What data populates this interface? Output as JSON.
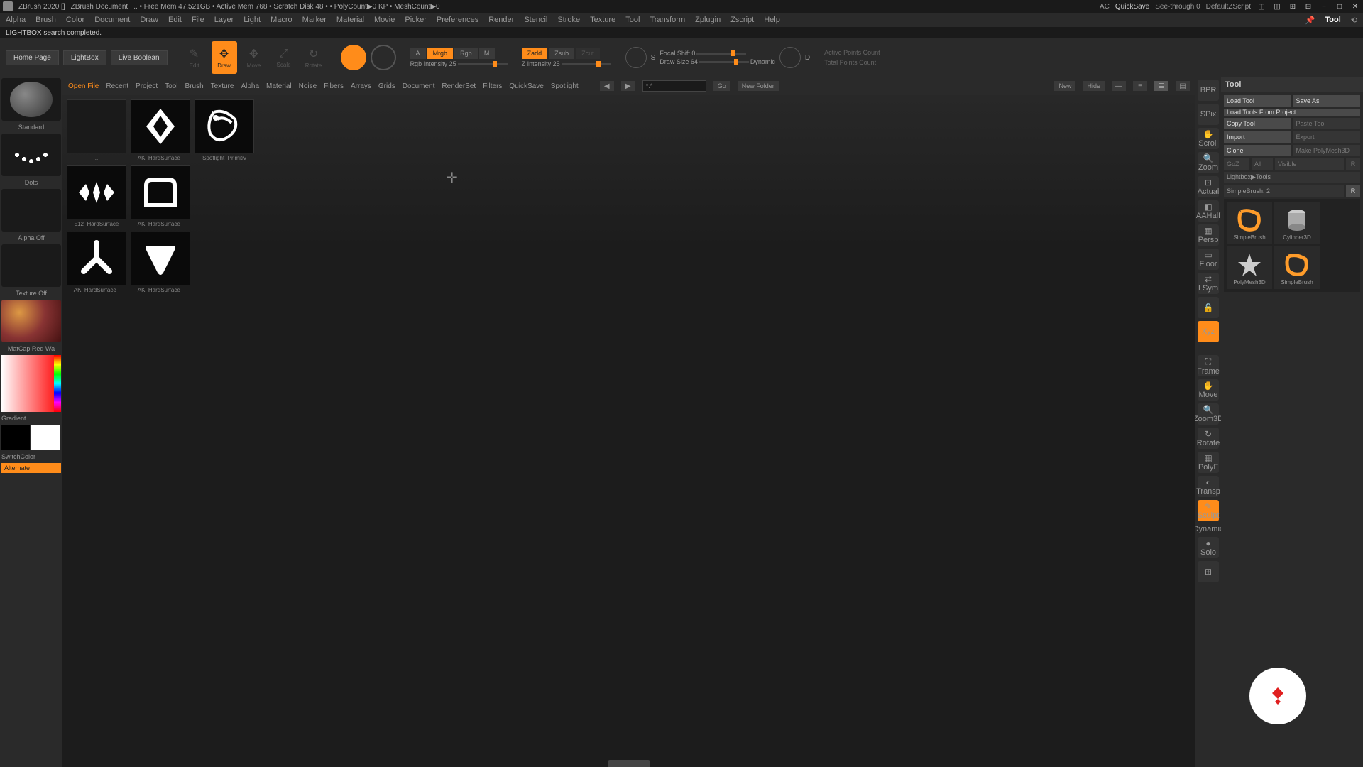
{
  "title_bar": {
    "app": "ZBrush 2020 []",
    "doc": "ZBrush Document",
    "mem": ".. • Free Mem 47.521GB • Active Mem 768 • Scratch Disk 48 • • PolyCount▶0 KP • MeshCount▶0",
    "ac": "AC",
    "quicksave": "QuickSave",
    "seethrough": "See-through  0",
    "default_zs": "DefaultZScript"
  },
  "menu": [
    "Alpha",
    "Brush",
    "Color",
    "Document",
    "Draw",
    "Edit",
    "File",
    "Layer",
    "Light",
    "Macro",
    "Marker",
    "Material",
    "Movie",
    "Picker",
    "Preferences",
    "Render",
    "Stencil",
    "Stroke",
    "Texture",
    "Tool",
    "Transform",
    "Zplugin",
    "Zscript",
    "Help"
  ],
  "status": "LIGHTBOX search completed.",
  "toolbar": {
    "home": "Home Page",
    "lightbox": "LightBox",
    "live_bool": "Live Boolean",
    "modes": {
      "edit": "Edit",
      "draw": "Draw",
      "move": "Move",
      "scale": "Scale",
      "rotate": "Rotate"
    },
    "a": "A",
    "mrgb": "Mrgb",
    "rgb": "Rgb",
    "m": "M",
    "rgb_int": "Rgb Intensity 25",
    "zadd": "Zadd",
    "zsub": "Zsub",
    "zcut": "Zcut",
    "z_int": "Z Intensity 25",
    "s_label": "S",
    "focal": "Focal Shift 0",
    "draw_size": "Draw Size 64",
    "dynamic": "Dynamic",
    "d_label": "D",
    "active_pts": "Active Points Count",
    "total_pts": "Total Points Count"
  },
  "left_palette": {
    "standard": "Standard",
    "dots": "Dots",
    "alpha_off": "Alpha Off",
    "texture_off": "Texture Off",
    "material": "MatCap Red Wa",
    "gradient": "Gradient",
    "switch_color": "SwitchColor",
    "alternate": "Alternate"
  },
  "lightbox": {
    "tabs": [
      "Open File",
      "Recent",
      "Project",
      "Tool",
      "Brush",
      "Texture",
      "Alpha",
      "Material",
      "Noise",
      "Fibers",
      "Arrays",
      "Grids",
      "Document",
      "RenderSet",
      "Filters",
      "QuickSave",
      "Spotlight"
    ],
    "active_tab": "Open File",
    "underline_tab": "Spotlight",
    "search_placeholder": "*.*",
    "go": "Go",
    "new_folder": "New Folder",
    "new": "New",
    "hide": "Hide",
    "items": [
      {
        "name": "..",
        "type": "folder"
      },
      {
        "name": "AK_HardSurface_",
        "type": "x"
      },
      {
        "name": "Spotlight_Primitiv",
        "type": "zlogo"
      },
      {
        "name": "512_HardSurface",
        "type": "diamond"
      },
      {
        "name": "AK_HardSurface_",
        "type": "tab"
      },
      {
        "name": "AK_HardSurface_",
        "type": "tri3"
      },
      {
        "name": "AK_HardSurface_",
        "type": "shield"
      }
    ]
  },
  "right_bar": {
    "bpr": "BPR",
    "spix": "SPix",
    "scroll": "Scroll",
    "zoom": "Zoom",
    "actual": "Actual",
    "aahalf": "AAHalf",
    "persp": "Persp",
    "floor": "Floor",
    "lsym": "LSym",
    "lock": "",
    "xyz": "Xyz",
    "frame": "Frame",
    "move": "Move",
    "zoom3d": "Zoom3D",
    "rotate": "Rotate",
    "polyf": "PolyF",
    "transp": "Transp",
    "sculpt": "Sculpt",
    "dynamic2": "Dynamic",
    "solo": "Solo"
  },
  "tool_panel": {
    "header": "Tool",
    "load_tool": "Load Tool",
    "save_as": "Save As",
    "load_project": "Load Tools From Project",
    "copy_tool": "Copy Tool",
    "paste_tool": "Paste Tool",
    "import": "Import",
    "export": "Export",
    "clone": "Clone",
    "make_poly": "Make PolyMesh3D",
    "goz": "GoZ",
    "all": "All",
    "visible": "Visible",
    "r1": "R",
    "breadcrumb": "Lightbox▶Tools",
    "current": "SimpleBrush. 2",
    "r2": "R",
    "tools": [
      {
        "name": "SimpleBrush",
        "icon": "s"
      },
      {
        "name": "Cylinder3D",
        "icon": "cyl"
      },
      {
        "name": "PolyMesh3D",
        "icon": "star"
      },
      {
        "name": "SimpleBrush",
        "icon": "s"
      }
    ]
  }
}
